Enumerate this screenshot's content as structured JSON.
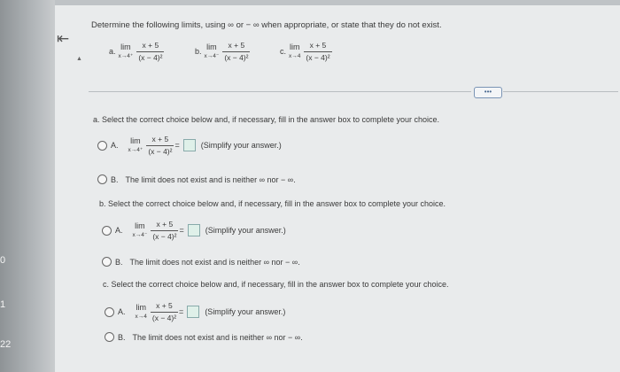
{
  "sidebar": {
    "numbers": [
      "0",
      "1",
      "22"
    ]
  },
  "nav": {
    "back_symbol": "⇤",
    "collapse_symbol": "▲"
  },
  "question": {
    "instruction": "Determine the following limits, using ∞ or − ∞ when appropriate, or state that they do not exist.",
    "parts": [
      {
        "label": "a.",
        "lim": "lim",
        "sub": "x→4⁺",
        "num": "x + 5",
        "den": "(x − 4)²"
      },
      {
        "label": "b.",
        "lim": "lim",
        "sub": "x→4⁻",
        "num": "x + 5",
        "den": "(x − 4)²"
      },
      {
        "label": "c.",
        "lim": "lim",
        "sub": "x→4",
        "num": "x + 5",
        "den": "(x − 4)²"
      }
    ],
    "more_button": "•••"
  },
  "sections": [
    {
      "heading": "a. Select the correct choice below and, if necessary, fill in the answer box to complete your choice.",
      "choice_a": {
        "letter": "A.",
        "lim": "lim",
        "sub": "x→4⁺",
        "num": "x + 5",
        "den": "(x − 4)²",
        "eq": "=",
        "hint": "(Simplify your answer.)"
      },
      "choice_b": {
        "letter": "B.",
        "text": "The limit does not exist and is neither ∞ nor − ∞."
      }
    },
    {
      "heading": "b. Select the correct choice below and, if necessary, fill in the answer box to complete your choice.",
      "choice_a": {
        "letter": "A.",
        "lim": "lim",
        "sub": "x→4⁻",
        "num": "x + 5",
        "den": "(x − 4)²",
        "eq": "=",
        "hint": "(Simplify your answer.)"
      },
      "choice_b": {
        "letter": "B.",
        "text": "The limit does not exist and is neither ∞ nor − ∞."
      }
    },
    {
      "heading": "c. Select the correct choice below and, if necessary, fill in the answer box to complete your choice.",
      "choice_a": {
        "letter": "A.",
        "lim": "lim",
        "sub": "x→4",
        "num": "x + 5",
        "den": "(x − 4)²",
        "eq": "=",
        "hint": "(Simplify your answer.)"
      },
      "choice_b": {
        "letter": "B.",
        "text": "The limit does not exist and is neither ∞ nor − ∞."
      }
    }
  ]
}
